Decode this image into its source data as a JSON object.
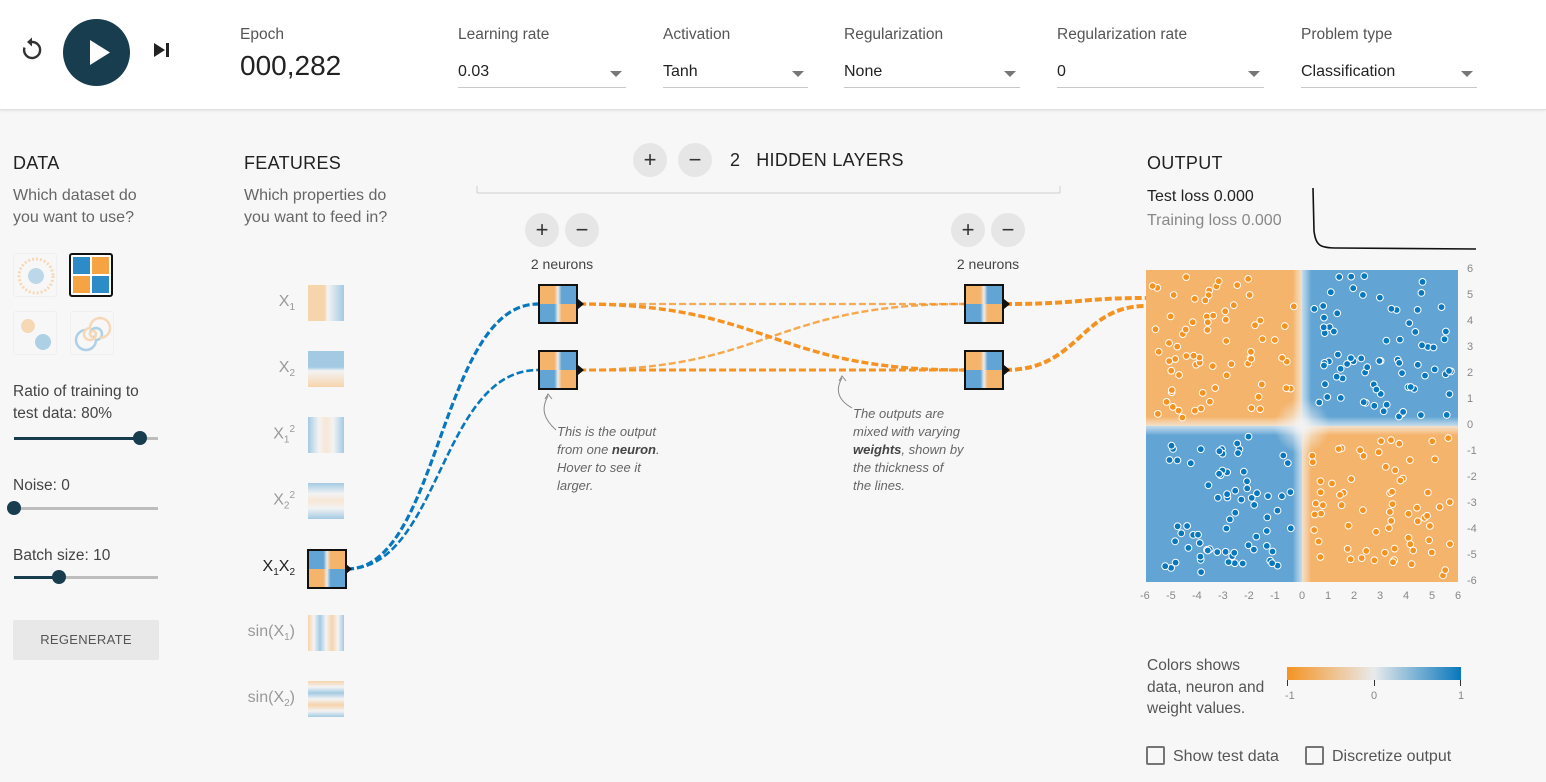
{
  "toolbar": {
    "reset_icon": "reset-icon",
    "play_icon": "play-icon",
    "step_icon": "step-icon",
    "epoch_label": "Epoch",
    "epoch_value": "000,282",
    "learning_rate_label": "Learning rate",
    "learning_rate_value": "0.03",
    "activation_label": "Activation",
    "activation_value": "Tanh",
    "regularization_label": "Regularization",
    "regularization_value": "None",
    "regularization_rate_label": "Regularization rate",
    "regularization_rate_value": "0",
    "problem_type_label": "Problem type",
    "problem_type_value": "Classification"
  },
  "data_panel": {
    "title": "DATA",
    "subtitle_line1": "Which dataset do",
    "subtitle_line2": "you want to use?",
    "datasets": [
      "circle",
      "xor",
      "gaussian",
      "spiral"
    ],
    "selected_dataset": "xor",
    "ratio_label_line1": "Ratio of training to",
    "ratio_label_line2": "test data:  80%",
    "ratio_value": 80,
    "noise_label": "Noise:  0",
    "noise_value": 0,
    "batch_label": "Batch size:  10",
    "batch_value": 10,
    "regenerate_label": "REGENERATE"
  },
  "features_panel": {
    "title": "FEATURES",
    "subtitle_line1": "Which properties do",
    "subtitle_line2": "you want to feed in?",
    "selected_feature": "X1X2"
  },
  "network": {
    "hidden_layers_count": "2",
    "hidden_layers_label": "HIDDEN LAYERS",
    "add_layer_icon": "plus-icon",
    "remove_layer_icon": "minus-icon",
    "layer1_neurons_label": "2 neurons",
    "layer2_neurons_label": "2 neurons",
    "callout_neuron_line1": "This is the output",
    "callout_neuron_line2_pre": "from one ",
    "callout_neuron_bold": "neuron",
    "callout_neuron_line2_post": ".",
    "callout_neuron_line3": "Hover to see it",
    "callout_neuron_line4": "larger.",
    "callout_weights_line1": "The outputs are",
    "callout_weights_line2": "mixed with varying",
    "callout_weights_bold": "weights",
    "callout_weights_line3_post": ", shown by",
    "callout_weights_line4": "the thickness of",
    "callout_weights_line5": "the lines."
  },
  "output_panel": {
    "title": "OUTPUT",
    "test_loss_label": "Test loss",
    "test_loss_value": "0.000",
    "training_loss_label": "Training loss",
    "training_loss_value": "0.000",
    "y_ticks": [
      "6",
      "5",
      "4",
      "3",
      "2",
      "1",
      "0",
      "-1",
      "-2",
      "-3",
      "-4",
      "-5",
      "-6"
    ],
    "x_ticks": [
      "-6",
      "-5",
      "-4",
      "-3",
      "-2",
      "-1",
      "0",
      "1",
      "2",
      "3",
      "4",
      "5",
      "6"
    ],
    "legend_line1": "Colors shows",
    "legend_line2": "data, neuron and",
    "legend_line3": "weight values.",
    "legend_ticks": [
      "-1",
      "0",
      "1"
    ],
    "show_test_data_label": "Show test data",
    "discretize_output_label": "Discretize output"
  },
  "colors": {
    "orange": "#f59322",
    "blue": "#0877bd",
    "dark": "#183d4e",
    "orange_region": "#f4b46b",
    "blue_region": "#62a4d3"
  }
}
